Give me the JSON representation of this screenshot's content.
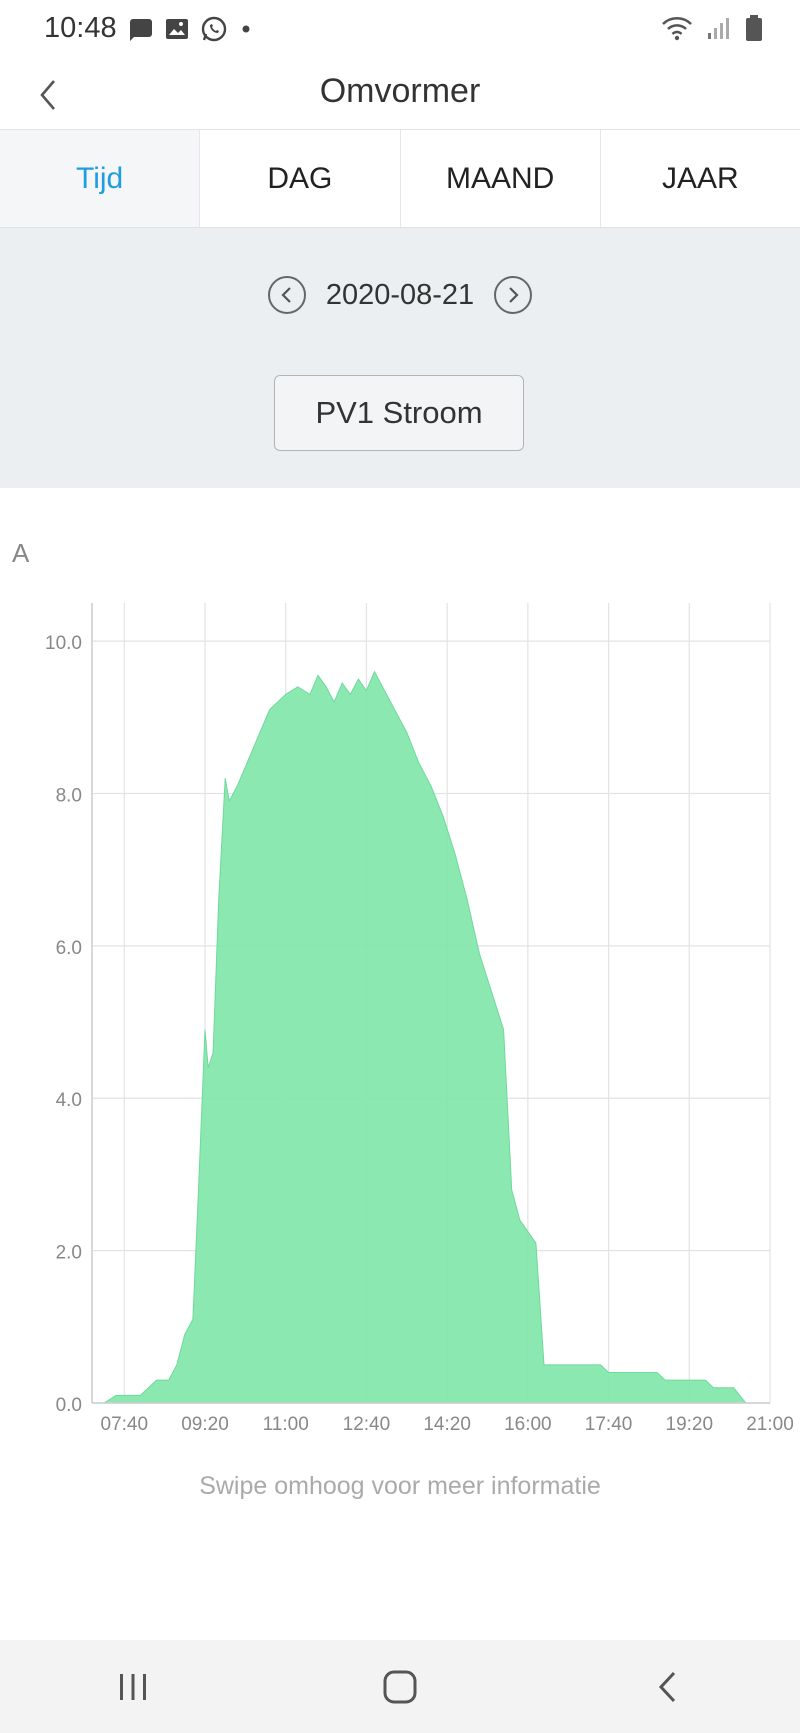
{
  "status": {
    "time": "10:48"
  },
  "header": {
    "title": "Omvormer"
  },
  "tabs": [
    {
      "label": "Tijd",
      "active": true
    },
    {
      "label": "DAG",
      "active": false
    },
    {
      "label": "MAAND",
      "active": false
    },
    {
      "label": "JAAR",
      "active": false
    }
  ],
  "date": "2020-08-21",
  "selector": "PV1 Stroom",
  "hint": "Swipe omhoog voor meer informatie",
  "colors": {
    "accent": "#1e9de0",
    "area": "#7ee6a8"
  },
  "chart_data": {
    "type": "area",
    "ylabel": "A",
    "ylim": [
      0,
      10.5
    ],
    "yticks": [
      "0.0",
      "2.0",
      "4.0",
      "6.0",
      "8.0",
      "10.0"
    ],
    "xticks": [
      "07:40",
      "09:20",
      "11:00",
      "12:40",
      "14:20",
      "16:00",
      "17:40",
      "19:20",
      "21:00"
    ],
    "xlim": [
      "07:00",
      "21:00"
    ],
    "series": [
      {
        "points": [
          [
            "07:15",
            0.0
          ],
          [
            "07:30",
            0.1
          ],
          [
            "08:00",
            0.1
          ],
          [
            "08:10",
            0.2
          ],
          [
            "08:20",
            0.3
          ],
          [
            "08:35",
            0.3
          ],
          [
            "08:45",
            0.5
          ],
          [
            "08:55",
            0.9
          ],
          [
            "09:05",
            1.1
          ],
          [
            "09:12",
            2.8
          ],
          [
            "09:20",
            4.9
          ],
          [
            "09:24",
            4.4
          ],
          [
            "09:30",
            4.6
          ],
          [
            "09:37",
            6.6
          ],
          [
            "09:45",
            8.2
          ],
          [
            "09:50",
            7.9
          ],
          [
            "10:00",
            8.1
          ],
          [
            "10:20",
            8.6
          ],
          [
            "10:40",
            9.1
          ],
          [
            "11:00",
            9.3
          ],
          [
            "11:15",
            9.4
          ],
          [
            "11:30",
            9.3
          ],
          [
            "11:40",
            9.55
          ],
          [
            "11:50",
            9.4
          ],
          [
            "12:00",
            9.2
          ],
          [
            "12:10",
            9.45
          ],
          [
            "12:20",
            9.3
          ],
          [
            "12:30",
            9.5
          ],
          [
            "12:40",
            9.35
          ],
          [
            "12:50",
            9.6
          ],
          [
            "13:00",
            9.4
          ],
          [
            "13:15",
            9.1
          ],
          [
            "13:30",
            8.8
          ],
          [
            "13:45",
            8.4
          ],
          [
            "14:00",
            8.1
          ],
          [
            "14:15",
            7.7
          ],
          [
            "14:30",
            7.2
          ],
          [
            "14:45",
            6.6
          ],
          [
            "15:00",
            5.9
          ],
          [
            "15:15",
            5.4
          ],
          [
            "15:30",
            4.9
          ],
          [
            "15:40",
            2.8
          ],
          [
            "15:50",
            2.4
          ],
          [
            "16:10",
            2.1
          ],
          [
            "16:20",
            0.5
          ],
          [
            "17:30",
            0.5
          ],
          [
            "17:40",
            0.4
          ],
          [
            "18:40",
            0.4
          ],
          [
            "18:50",
            0.3
          ],
          [
            "19:40",
            0.3
          ],
          [
            "19:50",
            0.2
          ],
          [
            "20:15",
            0.2
          ],
          [
            "20:30",
            0.0
          ]
        ]
      }
    ]
  }
}
